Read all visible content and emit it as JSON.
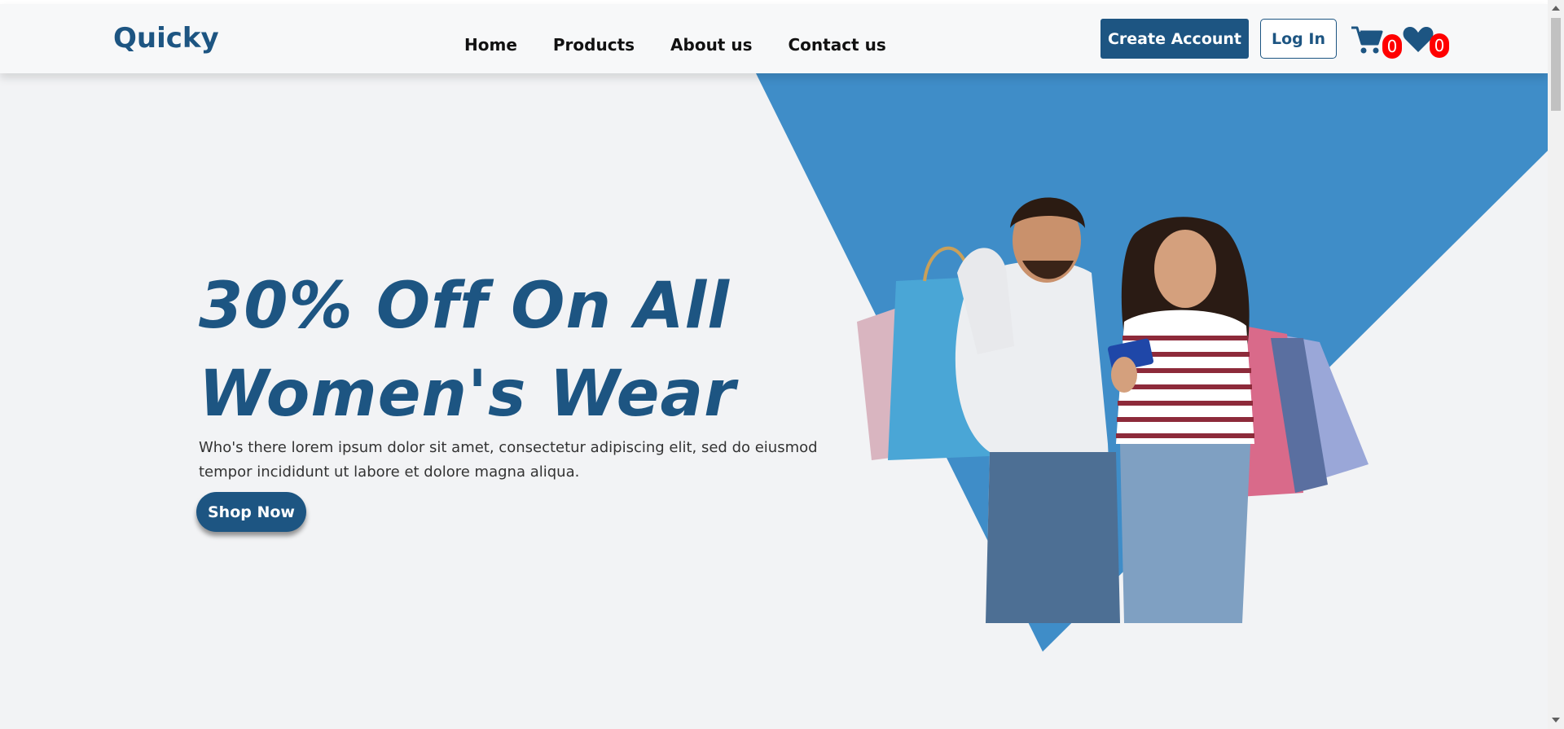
{
  "brand": {
    "logo": "Quicky"
  },
  "nav": {
    "links": [
      "Home",
      "Products",
      "About us",
      "Contact us"
    ]
  },
  "auth": {
    "create_account_label": "Create Account",
    "login_label": "Log In"
  },
  "counters": {
    "cart_count": "0",
    "wishlist_count": "0"
  },
  "hero": {
    "title_line1": "30% Off On All",
    "title_line2": "Women's Wear",
    "description_line1": "Who's there lorem ipsum dolor sit amet, consectetur adipiscing elit, sed do eiusmod",
    "description_line2": "tempor incididunt ut labore et dolore magna aliqua.",
    "cta_label": "Shop Now"
  },
  "icons": {
    "cart": "shopping-cart-icon",
    "wishlist": "heart-icon"
  },
  "colors": {
    "brand": "#1d5582",
    "accent": "#3f8dc8",
    "badge": "#ff0000",
    "background": "#f2f3f5"
  }
}
